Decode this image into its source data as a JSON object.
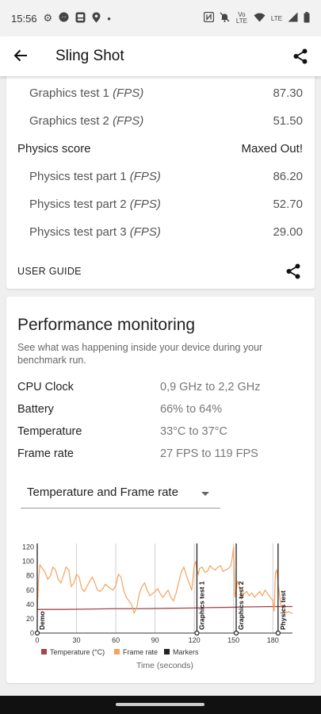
{
  "status_bar": {
    "time": "15:56",
    "left_icons": [
      "gear-icon",
      "messenger-icon",
      "app-icon",
      "location-icon",
      "dot-icon"
    ],
    "right_icons": [
      "nfc-icon",
      "mute-icon",
      "volte-icon",
      "wifi-icon",
      "lte-icon",
      "signal-icon",
      "battery-icon"
    ],
    "volte_text": "Vo LTE",
    "lte_text": "LTE"
  },
  "app_bar": {
    "title": "Sling Shot"
  },
  "results": {
    "graphics_test_1": {
      "label": "Graphics test 1",
      "unit": "(FPS)",
      "value": "87.30"
    },
    "graphics_test_2": {
      "label": "Graphics test 2",
      "unit": "(FPS)",
      "value": "51.50"
    },
    "physics_score": {
      "label": "Physics score",
      "value": "Maxed Out!"
    },
    "physics_test_1": {
      "label": "Physics test part 1",
      "unit": "(FPS)",
      "value": "86.20"
    },
    "physics_test_2": {
      "label": "Physics test part 2",
      "unit": "(FPS)",
      "value": "52.70"
    },
    "physics_test_3": {
      "label": "Physics test part 3",
      "unit": "(FPS)",
      "value": "29.00"
    },
    "user_guide": "USER GUIDE"
  },
  "performance": {
    "title": "Performance monitoring",
    "description": "See what was happening inside your device during your benchmark run.",
    "cpu_clock": {
      "label": "CPU Clock",
      "value": "0,9 GHz to 2,2 GHz"
    },
    "battery": {
      "label": "Battery",
      "value": "66% to 64%"
    },
    "temperature": {
      "label": "Temperature",
      "value": "33°C to 37°C"
    },
    "frame_rate": {
      "label": "Frame rate",
      "value": "27 FPS to 119 FPS"
    },
    "dropdown_selected": "Temperature and Frame rate"
  },
  "chart_data": {
    "type": "line",
    "xlabel": "Time (seconds)",
    "ylabel": "",
    "xlim": [
      0,
      195
    ],
    "ylim": [
      0,
      125
    ],
    "x_ticks": [
      0,
      30,
      60,
      90,
      120,
      150,
      180
    ],
    "y_ticks": [
      0,
      20,
      40,
      60,
      80,
      100,
      120
    ],
    "grid": "vertical",
    "legend_position": "bottom",
    "colors": {
      "temperature": "#a0484f",
      "frame_rate": "#f5a25d",
      "markers": "#222222"
    },
    "series": [
      {
        "name": "Temperature (°C)",
        "x": [
          0,
          20,
          40,
          60,
          80,
          100,
          120,
          130,
          150,
          160,
          180,
          195
        ],
        "y": [
          33,
          33,
          33.5,
          34,
          34,
          34.5,
          35,
          35.5,
          36,
          36.5,
          37,
          37
        ]
      },
      {
        "name": "Frame rate",
        "x": [
          0,
          1,
          2,
          4,
          6,
          8,
          10,
          12,
          14,
          16,
          18,
          20,
          22,
          24,
          26,
          28,
          30,
          32,
          34,
          36,
          38,
          40,
          42,
          44,
          46,
          48,
          50,
          52,
          54,
          56,
          58,
          60,
          62,
          64,
          66,
          68,
          70,
          72,
          74,
          76,
          78,
          80,
          82,
          84,
          86,
          88,
          90,
          92,
          94,
          96,
          98,
          100,
          102,
          104,
          106,
          108,
          110,
          112,
          114,
          116,
          118,
          120,
          121,
          122,
          123,
          124,
          126,
          128,
          130,
          132,
          134,
          136,
          138,
          140,
          142,
          144,
          146,
          148,
          149,
          150,
          151,
          152,
          153,
          154,
          156,
          158,
          160,
          162,
          164,
          166,
          168,
          170,
          172,
          174,
          176,
          178,
          180,
          181,
          182,
          183,
          184,
          186,
          188,
          190,
          192,
          195
        ],
        "y": [
          30,
          75,
          95,
          90,
          85,
          75,
          80,
          92,
          88,
          75,
          70,
          80,
          92,
          88,
          65,
          70,
          82,
          78,
          62,
          58,
          65,
          72,
          78,
          70,
          60,
          58,
          62,
          68,
          65,
          62,
          60,
          66,
          82,
          78,
          60,
          50,
          45,
          40,
          28,
          35,
          55,
          65,
          70,
          60,
          52,
          55,
          58,
          62,
          55,
          50,
          55,
          60,
          50,
          45,
          55,
          70,
          85,
          92,
          80,
          70,
          60,
          95,
          100,
          88,
          82,
          90,
          92,
          85,
          86,
          94,
          90,
          88,
          92,
          94,
          86,
          88,
          90,
          94,
          105,
          120,
          50,
          60,
          72,
          70,
          48,
          55,
          58,
          52,
          56,
          50,
          54,
          58,
          52,
          60,
          55,
          50,
          45,
          30,
          85,
          88,
          70,
          40,
          32,
          28,
          30,
          27
        ]
      }
    ],
    "markers": [
      {
        "label": "Demo",
        "x": 0
      },
      {
        "label": "Graphics test 1",
        "x": 122
      },
      {
        "label": "Graphics test 2",
        "x": 152
      },
      {
        "label": "Physics test",
        "x": 184
      }
    ],
    "legend": [
      "Temperature (°C)",
      "Frame rate",
      "Markers"
    ]
  }
}
